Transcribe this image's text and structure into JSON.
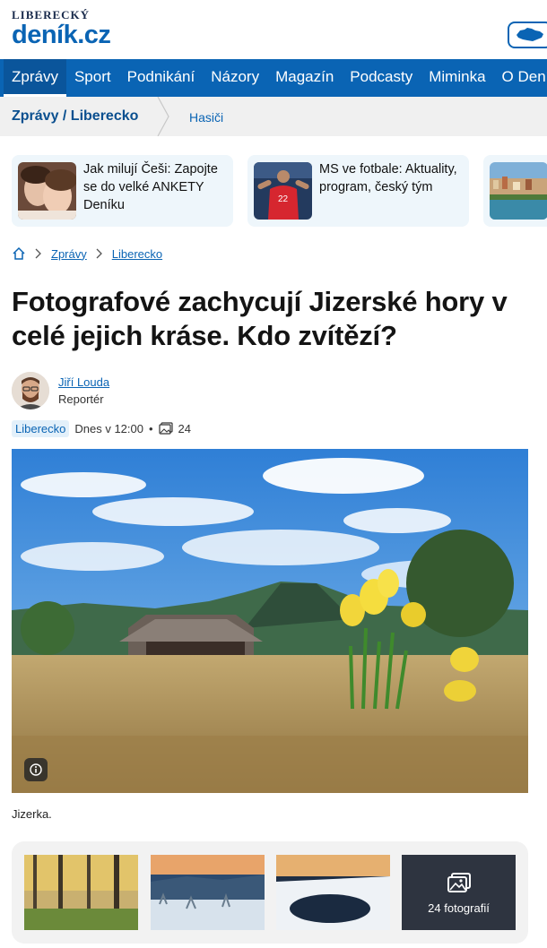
{
  "header": {
    "logo_small": "LIBERECKÝ",
    "logo_big": "deník.cz"
  },
  "nav": {
    "items": [
      "Zprávy",
      "Sport",
      "Podnikání",
      "Názory",
      "Magazín",
      "Podcasty",
      "Miminka",
      "O Deník"
    ],
    "active": "Zprávy"
  },
  "section": {
    "title": "Zprávy / Liberecko",
    "sub": "Hasiči"
  },
  "promos": [
    {
      "text": "Jak milují Češi: Zapojte se do velké ANKETY Deníku",
      "thumb_icon": "couple-photo"
    },
    {
      "text": "MS ve fotbale: Aktuality, program, český tým",
      "thumb_icon": "football-player-photo"
    },
    {
      "text": "",
      "thumb_icon": "city-photo"
    }
  ],
  "breadcrumb": {
    "items": [
      "Zprávy",
      "Liberecko"
    ]
  },
  "article": {
    "title": "Fotografové zachycují Jizerské hory v celé jejich kráse. Kdo zvítězí?",
    "author_name": "Jiří Louda",
    "author_role": "Reportér",
    "tag": "Liberecko",
    "time": "Dnes v 12:00",
    "dot": "•",
    "photo_count": "24",
    "caption": "Jizerka."
  },
  "gallery": {
    "more_label": "24 fotografií"
  },
  "colors": {
    "brand": "#0a64b4",
    "nav_bg": "#0a64b4",
    "section_bg": "#f0f0f0",
    "promo_bg": "#eef6fb"
  }
}
